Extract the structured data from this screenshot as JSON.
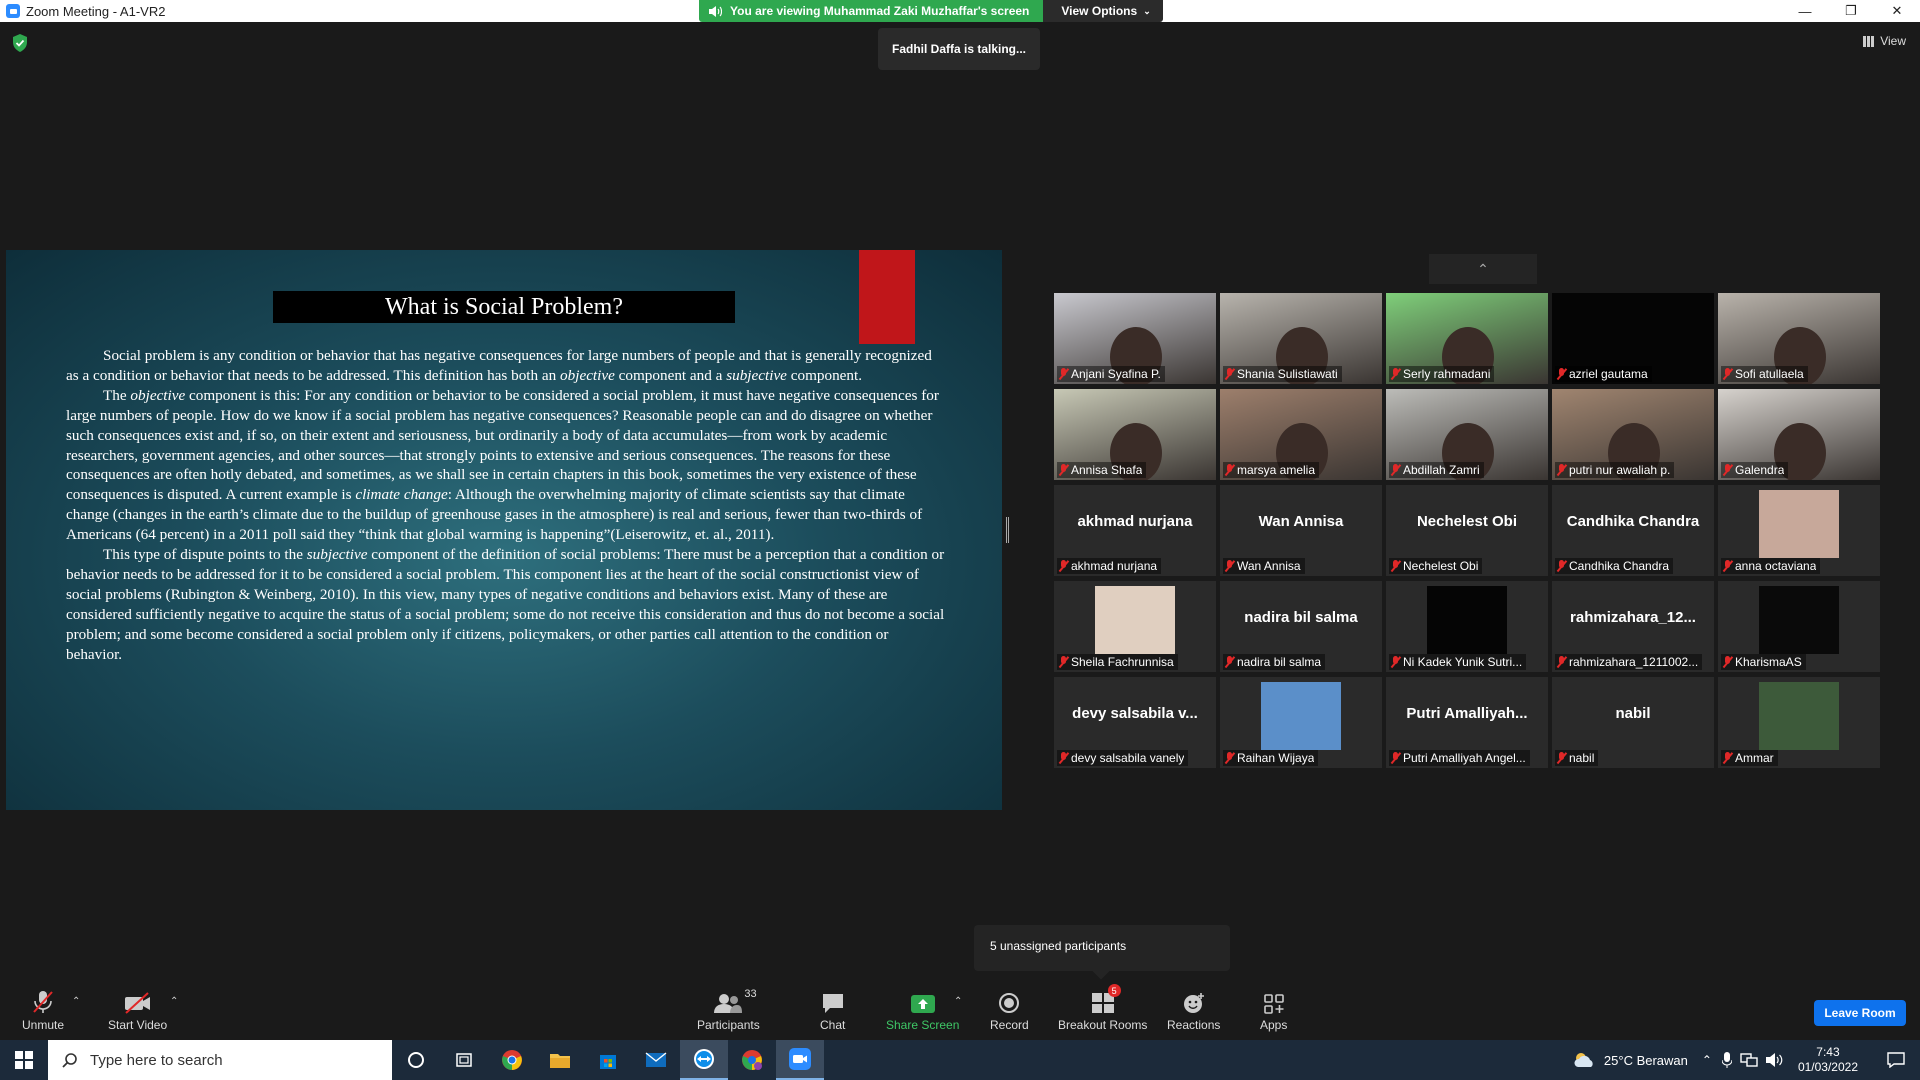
{
  "window": {
    "title": "Zoom Meeting - A1-VR2",
    "minimize": "—",
    "maximize": "❐",
    "close": "✕"
  },
  "share_banner": {
    "viewing_text": "You are viewing Muhammad Zaki Muzhaffar's screen",
    "view_options_label": "View Options"
  },
  "talking_indicator": "Fadhil Daffa is talking...",
  "view_button_label": "View",
  "slide": {
    "title": "What is Social Problem?",
    "paragraphs": [
      [
        {
          "t": "Social problem is any condition or behavior that has negative consequences for large numbers of people and that is generally recognized as a condition or behavior that needs to be addressed. This definition has both an "
        },
        {
          "t": "objective",
          "i": true
        },
        {
          "t": " component and a "
        },
        {
          "t": "subjective",
          "i": true
        },
        {
          "t": " component."
        }
      ],
      [
        {
          "t": "The "
        },
        {
          "t": "objective",
          "i": true
        },
        {
          "t": " component is this: For any condition or behavior to be considered a social problem, it must have negative consequences for large numbers of people. How do we know if a social problem has negative consequences? Reasonable people can and do disagree on whether such consequences exist and, if so, on their extent and seriousness, but ordinarily a body of data accumulates—from work by academic researchers, government agencies, and other sources—that strongly points to extensive and serious consequences. The reasons for these consequences are often hotly debated, and sometimes, as we shall see in certain chapters in this book, sometimes the very existence of these consequences is disputed. A current example is "
        },
        {
          "t": "climate change",
          "i": true
        },
        {
          "t": ": Although the overwhelming majority of climate scientists say that climate change (changes in the earth’s climate due to the buildup of greenhouse gases in the atmosphere) is real and serious, fewer than two-thirds of Americans (64 percent) in a 2011 poll said they “think that global warming is happening”(Leiserowitz, et. al., 2011)."
        }
      ],
      [
        {
          "t": "This type of dispute points to the "
        },
        {
          "t": "subjective",
          "i": true
        },
        {
          "t": " component of the definition of social problems: There must be a perception that a condition or behavior needs to be addressed for it to be considered a social problem. This component lies at the heart of the social constructionist view of social problems (Rubington & Weinberg, 2010). In this view, many types of negative conditions and behaviors exist. Many of these are considered sufficiently negative to acquire the status of a social problem; some do not receive this consideration and thus do not become a social problem; and some become considered a social problem only if citizens, policymakers, or other parties call attention to the condition or behavior."
        }
      ]
    ]
  },
  "participants": [
    {
      "label": "Anjani Syafina P.",
      "kind": "video",
      "bg": "#c9c9cf"
    },
    {
      "label": "Shania Sulistiawati",
      "kind": "video",
      "bg": "#b8b4ad"
    },
    {
      "label": "Serly rahmadani",
      "kind": "video",
      "bg": "#7fcf7a"
    },
    {
      "label": "azriel gautama",
      "kind": "black",
      "bg": "#050505"
    },
    {
      "label": "Sofi atullaela",
      "kind": "video",
      "bg": "#b9b3ab"
    },
    {
      "label": "Annisa Shafa",
      "kind": "video",
      "bg": "#c7c8b5"
    },
    {
      "label": "marsya amelia",
      "kind": "video",
      "bg": "#9d7f6c"
    },
    {
      "label": "Abdillah Zamri",
      "kind": "video",
      "bg": "#bcbcb8"
    },
    {
      "label": "putri nur awaliah p.",
      "kind": "video",
      "bg": "#a08570"
    },
    {
      "label": "Galendra",
      "kind": "video",
      "bg": "#d6d2cd"
    },
    {
      "label": "akhmad nurjana",
      "kind": "name",
      "center": "akhmad nurjana"
    },
    {
      "label": "Wan Annisa",
      "kind": "name",
      "center": "Wan Annisa"
    },
    {
      "label": "Nechelest Obi",
      "kind": "name",
      "center": "Nechelest Obi"
    },
    {
      "label": "Candhika Chandra",
      "kind": "name",
      "center": "Candhika Chandra"
    },
    {
      "label": "anna octaviana",
      "kind": "avatar",
      "bg": "#c7a89a"
    },
    {
      "label": "Sheila Fachrunnisa",
      "kind": "avatar",
      "bg": "#e0cfc0"
    },
    {
      "label": "nadira bil salma",
      "kind": "name",
      "center": "nadira bil salma"
    },
    {
      "label": "Ni  Kadek Yunik Sutri...",
      "kind": "avatar",
      "bg": "#050505"
    },
    {
      "label": "rahmizahara_1211002...",
      "kind": "name",
      "center": "rahmizahara_12..."
    },
    {
      "label": "KharismaAS",
      "kind": "avatar",
      "bg": "#0a0a0a"
    },
    {
      "label": "devy salsabila vanely",
      "kind": "name",
      "center": "devy salsabila v..."
    },
    {
      "label": "Raihan Wijaya",
      "kind": "avatar",
      "bg": "#5b8fc9"
    },
    {
      "label": "Putri Amalliyah Angel...",
      "kind": "name",
      "center": "Putri  Amalliyah..."
    },
    {
      "label": "nabil",
      "kind": "name",
      "center": "nabil"
    },
    {
      "label": "Ammar",
      "kind": "avatar",
      "bg": "#3d5a3a"
    }
  ],
  "unassigned_popup": "5 unassigned participants",
  "toolbar": {
    "unmute": "Unmute",
    "start_video": "Start Video",
    "participants": "Participants",
    "participants_count": "33",
    "chat": "Chat",
    "share_screen": "Share Screen",
    "record": "Record",
    "breakout_rooms": "Breakout Rooms",
    "breakout_badge": "5",
    "reactions": "Reactions",
    "apps": "Apps",
    "leave_room": "Leave Room"
  },
  "taskbar": {
    "search_placeholder": "Type here to search",
    "weather": "25°C  Berawan",
    "time": "7:43",
    "date": "01/03/2022"
  },
  "colors": {
    "accent": "#0e72ed",
    "banner_green": "#2fa84f",
    "mute_red": "#e02828",
    "slide_red": "#c0161a"
  }
}
